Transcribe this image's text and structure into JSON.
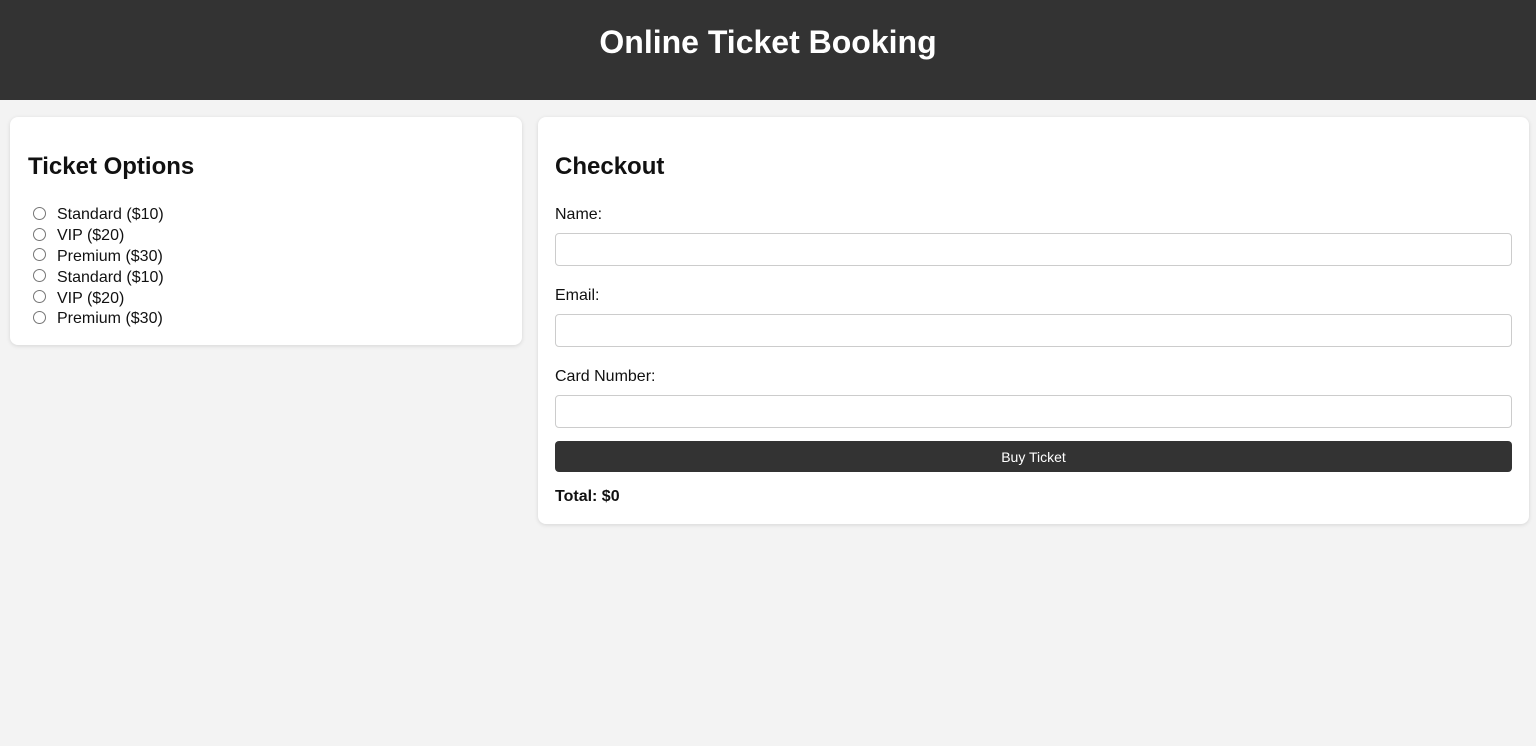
{
  "header": {
    "title": "Online Ticket Booking"
  },
  "ticket_options": {
    "heading": "Ticket Options",
    "items": [
      {
        "label": "Standard ($10)"
      },
      {
        "label": "VIP ($20)"
      },
      {
        "label": "Premium ($30)"
      },
      {
        "label": "Standard ($10)"
      },
      {
        "label": "VIP ($20)"
      },
      {
        "label": "Premium ($30)"
      }
    ]
  },
  "checkout": {
    "heading": "Checkout",
    "name_label": "Name:",
    "name_value": "",
    "email_label": "Email:",
    "email_value": "",
    "card_label": "Card Number:",
    "card_value": "",
    "buy_label": "Buy Ticket",
    "total_text": "Total: $0"
  },
  "colors": {
    "header_bg": "#333333",
    "page_bg": "#f3f3f3",
    "button_bg": "#333333"
  }
}
